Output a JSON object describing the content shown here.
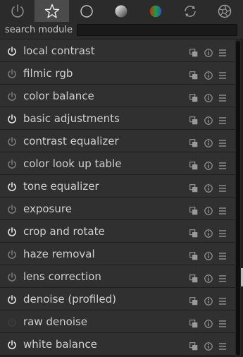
{
  "search": {
    "label": "search module",
    "value": "",
    "placeholder": ""
  },
  "tabs": [
    {
      "icon": "power-icon",
      "active": false
    },
    {
      "icon": "star-icon",
      "active": true
    },
    {
      "icon": "circle-outline-icon",
      "active": false
    },
    {
      "icon": "gradient-sphere-icon",
      "active": false
    },
    {
      "icon": "color-wheel-icon",
      "active": false
    },
    {
      "icon": "circular-arrows-icon",
      "active": false
    },
    {
      "icon": "aperture-icon",
      "active": false
    }
  ],
  "modules": [
    {
      "label": "local contrast",
      "power": "on"
    },
    {
      "label": "filmic rgb",
      "power": "off"
    },
    {
      "label": "color balance",
      "power": "off"
    },
    {
      "label": "basic adjustments",
      "power": "on"
    },
    {
      "label": "contrast equalizer",
      "power": "off"
    },
    {
      "label": "color look up table",
      "power": "off"
    },
    {
      "label": "tone equalizer",
      "power": "on"
    },
    {
      "label": "exposure",
      "power": "off"
    },
    {
      "label": "crop and rotate",
      "power": "on"
    },
    {
      "label": "haze removal",
      "power": "off"
    },
    {
      "label": "lens correction",
      "power": "off"
    },
    {
      "label": "denoise (profiled)",
      "power": "on"
    },
    {
      "label": "raw denoise",
      "power": "unavailable"
    },
    {
      "label": "white balance",
      "power": "on"
    }
  ],
  "colors": {
    "power_on": "#e6e6e6",
    "power_off": "#7a7a7a",
    "power_unavailable": "#3d3d3d"
  }
}
